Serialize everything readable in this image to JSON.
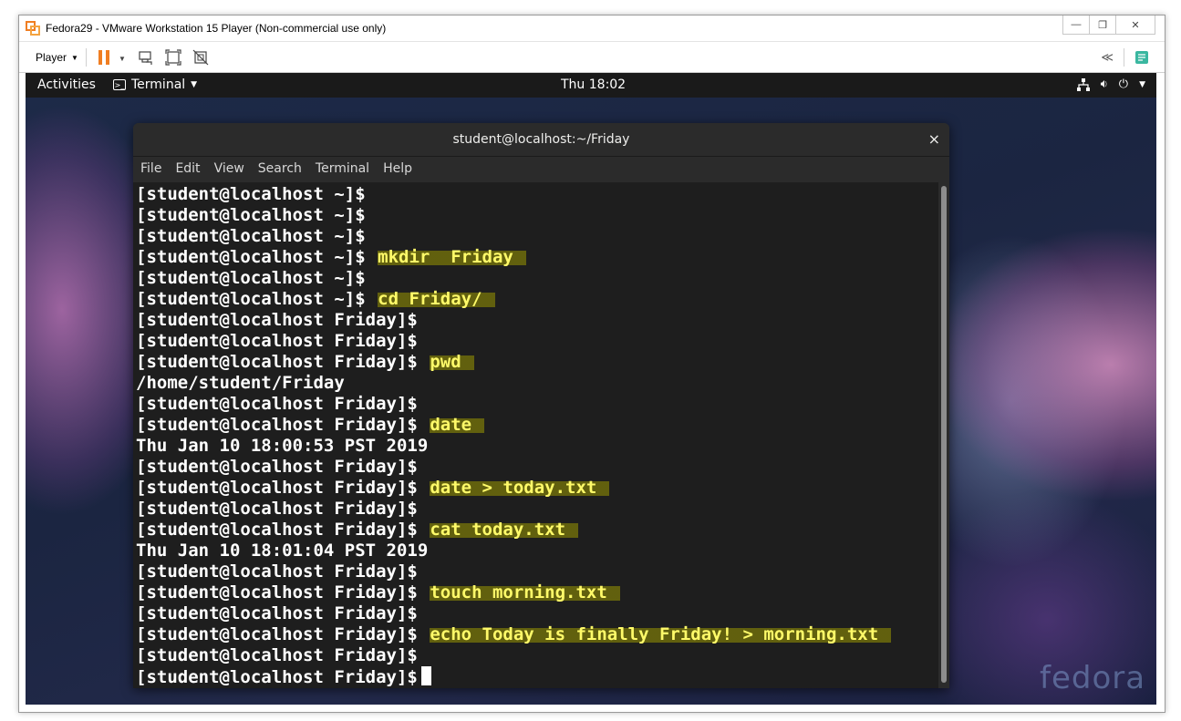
{
  "vmware": {
    "title": "Fedora29 - VMware Workstation 15 Player (Non-commercial use only)",
    "player_menu": "Player",
    "minimize": "—",
    "restore": "❐",
    "close": "✕",
    "collapse_arrows": "≪"
  },
  "gnome": {
    "activities": "Activities",
    "app_menu": "Terminal",
    "clock": "Thu 18:02"
  },
  "terminal": {
    "title": "student@localhost:~/Friday",
    "close": "×",
    "menu": [
      "File",
      "Edit",
      "View",
      "Search",
      "Terminal",
      "Help"
    ],
    "lines": [
      {
        "prompt": "[student@localhost ~]$",
        "cmd": ""
      },
      {
        "prompt": "[student@localhost ~]$",
        "cmd": ""
      },
      {
        "prompt": "[student@localhost ~]$",
        "cmd": ""
      },
      {
        "prompt": "[student@localhost ~]$",
        "cmd": "mkdir  Friday"
      },
      {
        "prompt": "[student@localhost ~]$",
        "cmd": ""
      },
      {
        "prompt": "[student@localhost ~]$",
        "cmd": "cd Friday/"
      },
      {
        "prompt": "[student@localhost Friday]$",
        "cmd": ""
      },
      {
        "prompt": "[student@localhost Friday]$",
        "cmd": ""
      },
      {
        "prompt": "[student@localhost Friday]$",
        "cmd": "pwd"
      },
      {
        "prompt": "/home/student/Friday",
        "cmd": ""
      },
      {
        "prompt": "[student@localhost Friday]$",
        "cmd": ""
      },
      {
        "prompt": "[student@localhost Friday]$",
        "cmd": "date"
      },
      {
        "prompt": "Thu Jan 10 18:00:53 PST 2019",
        "cmd": ""
      },
      {
        "prompt": "[student@localhost Friday]$",
        "cmd": ""
      },
      {
        "prompt": "[student@localhost Friday]$",
        "cmd": "date > today.txt"
      },
      {
        "prompt": "[student@localhost Friday]$",
        "cmd": ""
      },
      {
        "prompt": "[student@localhost Friday]$",
        "cmd": "cat today.txt"
      },
      {
        "prompt": "Thu Jan 10 18:01:04 PST 2019",
        "cmd": ""
      },
      {
        "prompt": "[student@localhost Friday]$",
        "cmd": ""
      },
      {
        "prompt": "[student@localhost Friday]$",
        "cmd": "touch morning.txt"
      },
      {
        "prompt": "[student@localhost Friday]$",
        "cmd": ""
      },
      {
        "prompt": "[student@localhost Friday]$",
        "cmd": "echo Today is finally Friday! > morning.txt"
      },
      {
        "prompt": "[student@localhost Friday]$",
        "cmd": ""
      },
      {
        "prompt": "[student@localhost Friday]$",
        "cmd": "",
        "cursor": true
      }
    ]
  },
  "wallpaper_logo": "fedora",
  "icons": {
    "pause": "pause-icon",
    "send_keys": "send-ctrl-alt-del-icon",
    "fit": "fit-guest-icon",
    "unity": "unity-icon",
    "network": "network-icon",
    "volume": "volume-icon",
    "power": "power-icon"
  },
  "colors": {
    "highlight": "#fffa69",
    "terminal_bg": "#1e1e1e",
    "pause_orange": "#f07e22"
  }
}
